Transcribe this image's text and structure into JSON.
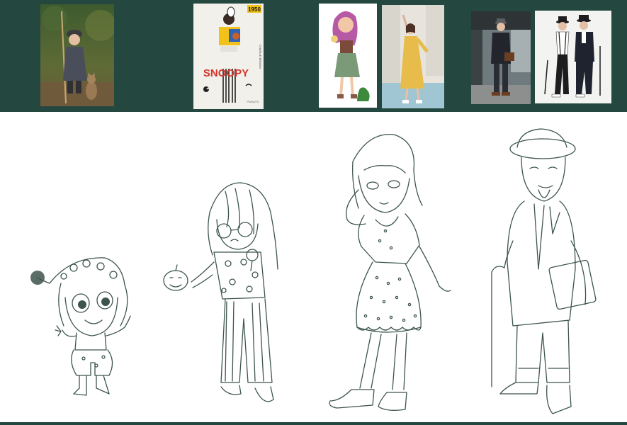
{
  "colors": {
    "band": "#24473f",
    "sketch_line": "#3d554c",
    "poster_red": "#d3352b",
    "poster_yellow": "#f2c21a",
    "dress_yellow": "#e8bc4a"
  },
  "reference_groups": [
    {
      "name": "toddler-with-cat",
      "photos": [
        "girl-in-hat-with-cat-photo"
      ]
    },
    {
      "name": "snoopy-poster",
      "photos": [
        "snoopy-fashion-poster"
      ]
    },
    {
      "name": "girl-in-dress",
      "photos": [
        "cartoon-girl-illustration",
        "yellow-dress-model-photo"
      ]
    },
    {
      "name": "gentleman-with-cane",
      "photos": [
        "man-in-suit-station-photo",
        "two-men-hats-canes-photo"
      ]
    }
  ],
  "poster": {
    "badge": "1950",
    "title": "SNOOPY",
    "side_caption": "CHARLIE BROWN",
    "corner_caption": "PEANUTS"
  },
  "sketches": [
    "toddler-sketch",
    "girl-with-pumpkin-sketch",
    "girl-in-polka-dress-sketch",
    "old-man-with-cane-sketch"
  ]
}
